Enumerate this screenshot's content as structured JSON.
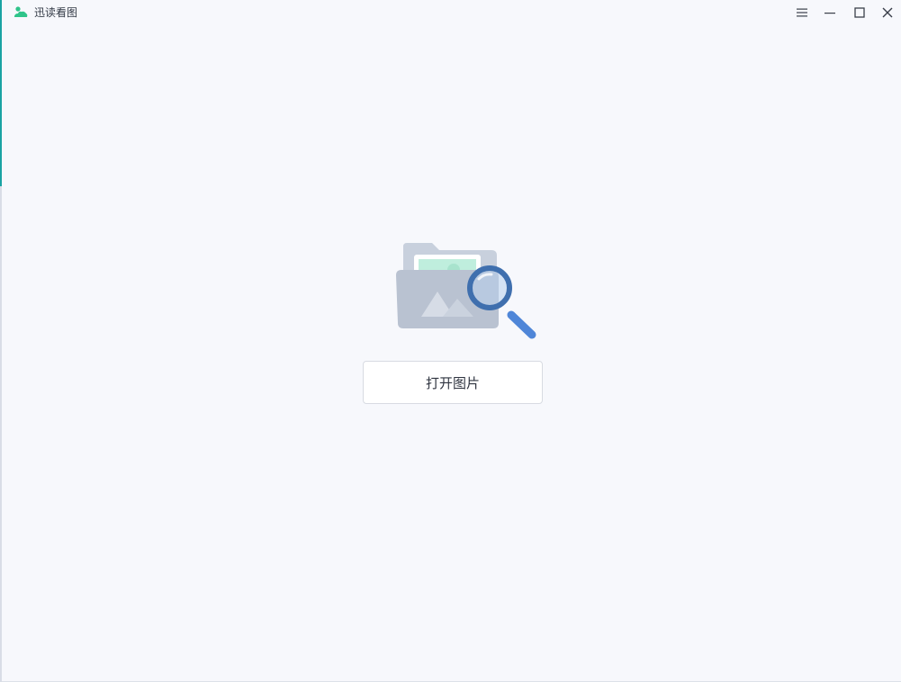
{
  "app": {
    "title": "迅读看图",
    "logo_icon": "cloud-leaf-icon",
    "brand_color": "#2fc48a"
  },
  "window_controls": {
    "menu_icon": "hamburger-menu-icon",
    "minimize_icon": "minimize-icon",
    "maximize_icon": "maximize-icon",
    "close_icon": "close-icon"
  },
  "empty_state": {
    "illustration_icon": "folder-image-search-icon",
    "open_button_label": "打开图片"
  }
}
